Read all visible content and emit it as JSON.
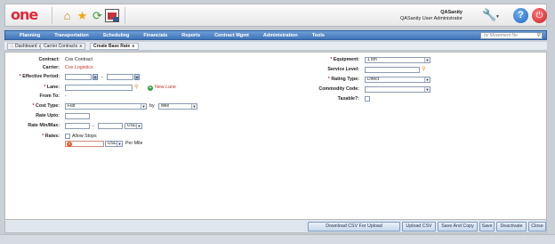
{
  "header": {
    "logo": "one",
    "user_name": "QASanity",
    "user_role": "QASanity User Administrator"
  },
  "icons": [
    "home-icon",
    "favorites-star-icon",
    "refresh-icon",
    "report-picture-icon",
    "wrench-icon",
    "help-icon",
    "power-icon"
  ],
  "nav": {
    "items": [
      "Planning",
      "Transportation",
      "Scheduling",
      "Financials",
      "Reports",
      "Contract Mgmt",
      "Administration",
      "Tools"
    ],
    "search_placeholder": "by Movement No"
  },
  "tabs": [
    "Dashboard",
    "Carrier Contracts",
    "Create Base Rate"
  ],
  "form": {
    "contract_label": "Contract:",
    "contract_value": "Cox Contract",
    "carrier_label": "Carrier:",
    "carrier_value": "Cox Logistics",
    "effective_period_label": "Effective Period:",
    "effective_dash": "-",
    "lane_label": "Lane:",
    "new_lane": "New Lane",
    "from_to_label": "From To:",
    "from_to_value": "-",
    "cost_type_label": "Cost Type:",
    "cost_type_value": "Flat",
    "by_label": "by",
    "by_value": "Mile",
    "rate_upto_label": "Rate Upto:",
    "rate_minmax_label": "Rate Min/Max:",
    "minmax_dash": "-",
    "minmax_currency": "USD",
    "rates_label": "Rates:",
    "allow_stops_label": "Allow Stops",
    "rate_currency": "USD",
    "per_mile": "Per Mile",
    "equipment_label": "Equipment:",
    "equipment_value": "1Ton",
    "service_level_label": "Service Level:",
    "rating_type_label": "Rating Type:",
    "rating_type_value": "Direct",
    "commodity_code_label": "Commodity Code:",
    "taxable_label": "Taxable?:"
  },
  "footer": {
    "buttons": [
      "Download CSV For Upload",
      "Upload CSV",
      "Save And Copy",
      "Save",
      "Deactivate",
      "Close"
    ]
  },
  "colors": {
    "nav_bar": "#4a7fc1",
    "brand_red": "#e0293b",
    "link_red": "#c0392b"
  }
}
